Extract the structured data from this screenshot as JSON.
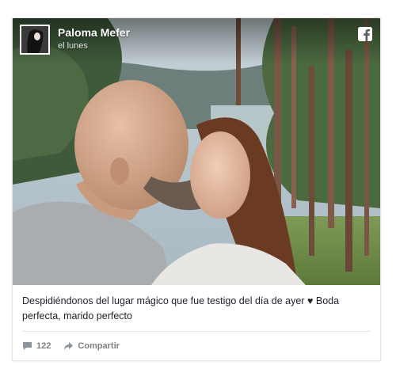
{
  "post": {
    "author": "Paloma Mefer",
    "timestamp": "el lunes",
    "caption": "Despidiéndonos del lugar mágico que fue testigo del día de ayer ♥ Boda perfecta, marido perfecto",
    "comment_count": "122",
    "share_label": "Compartir"
  },
  "icons": {
    "brand": "facebook-icon",
    "comments": "comment-icon",
    "share": "share-arrow-icon"
  },
  "colors": {
    "text": "#1d2129",
    "muted": "#7f7f7f",
    "divider": "#e5e5e5"
  }
}
